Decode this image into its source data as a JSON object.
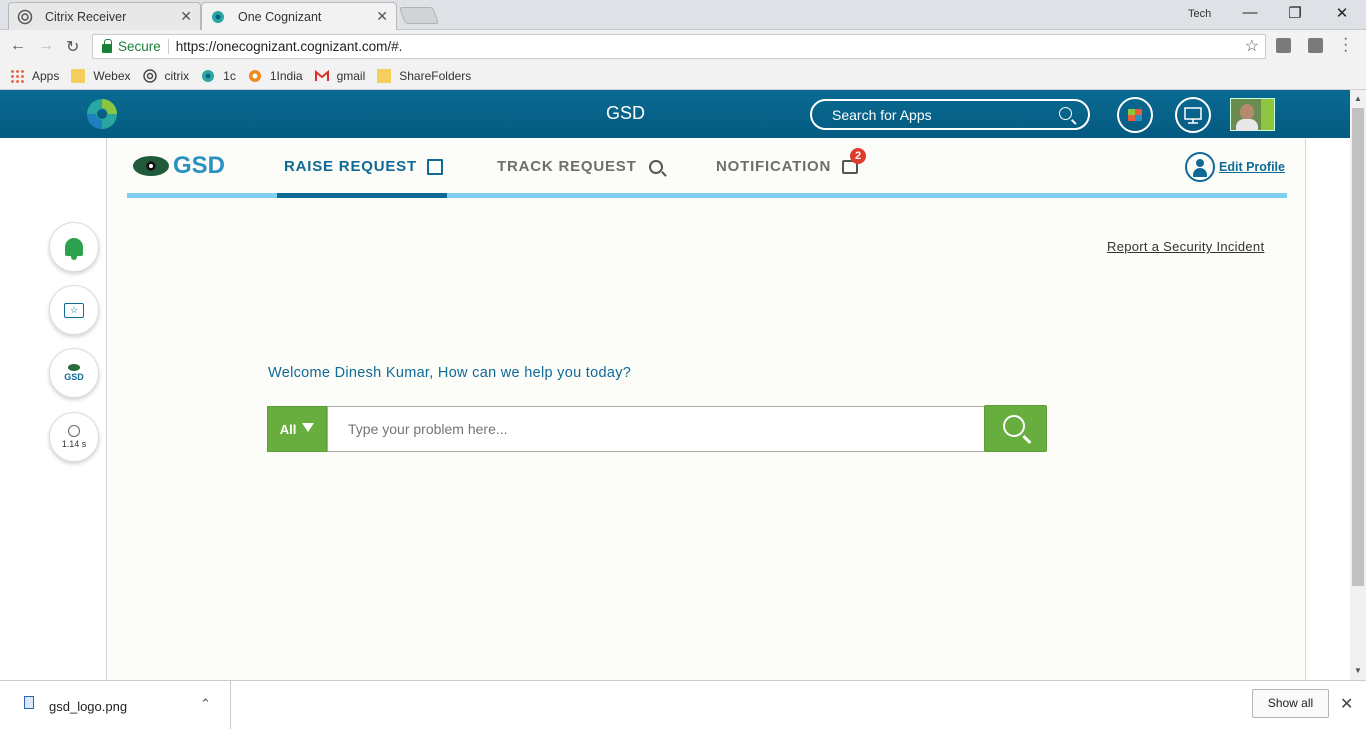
{
  "browser": {
    "tabs": [
      {
        "title": "Citrix Receiver",
        "active": false
      },
      {
        "title": "One Cognizant",
        "active": true
      }
    ],
    "window_user": "Tech",
    "secure_label": "Secure",
    "url": "https://onecognizant.cognizant.com/#.",
    "bookmarks": [
      {
        "label": "Apps",
        "icon": "apps-grid-icon"
      },
      {
        "label": "Webex",
        "icon": "folder-icon"
      },
      {
        "label": "citrix",
        "icon": "citrix-icon"
      },
      {
        "label": "1c",
        "icon": "onecognizant-icon"
      },
      {
        "label": "1India",
        "icon": "1india-icon"
      },
      {
        "label": "gmail",
        "icon": "gmail-icon"
      },
      {
        "label": "ShareFolders",
        "icon": "folder-icon"
      }
    ]
  },
  "appbar": {
    "title": "GSD",
    "search_label": "Search for Apps"
  },
  "rail": {
    "gsd_label": "GSD",
    "timer_label": "1.14 s"
  },
  "main": {
    "brand": "GSD",
    "tabs": [
      {
        "label": "RAISE REQUEST",
        "active": true
      },
      {
        "label": "TRACK REQUEST",
        "active": false
      },
      {
        "label": "NOTIFICATION",
        "active": false
      }
    ],
    "notification_count": "2",
    "edit_profile": "Edit Profile",
    "security_link": "Report a Security Incident",
    "welcome": "Welcome Dinesh Kumar, How can we help you today?",
    "category": "All",
    "problem_placeholder": "Type your problem here..."
  },
  "downloads": {
    "file_name": "gsd_logo.png",
    "show_all": "Show all"
  },
  "colors": {
    "header_blue": "#0a6b93",
    "accent_green": "#67ae3e",
    "brand_teal": "#0f6a96",
    "tab_underline": "#7fcff0",
    "badge_red": "#e03a2e"
  }
}
